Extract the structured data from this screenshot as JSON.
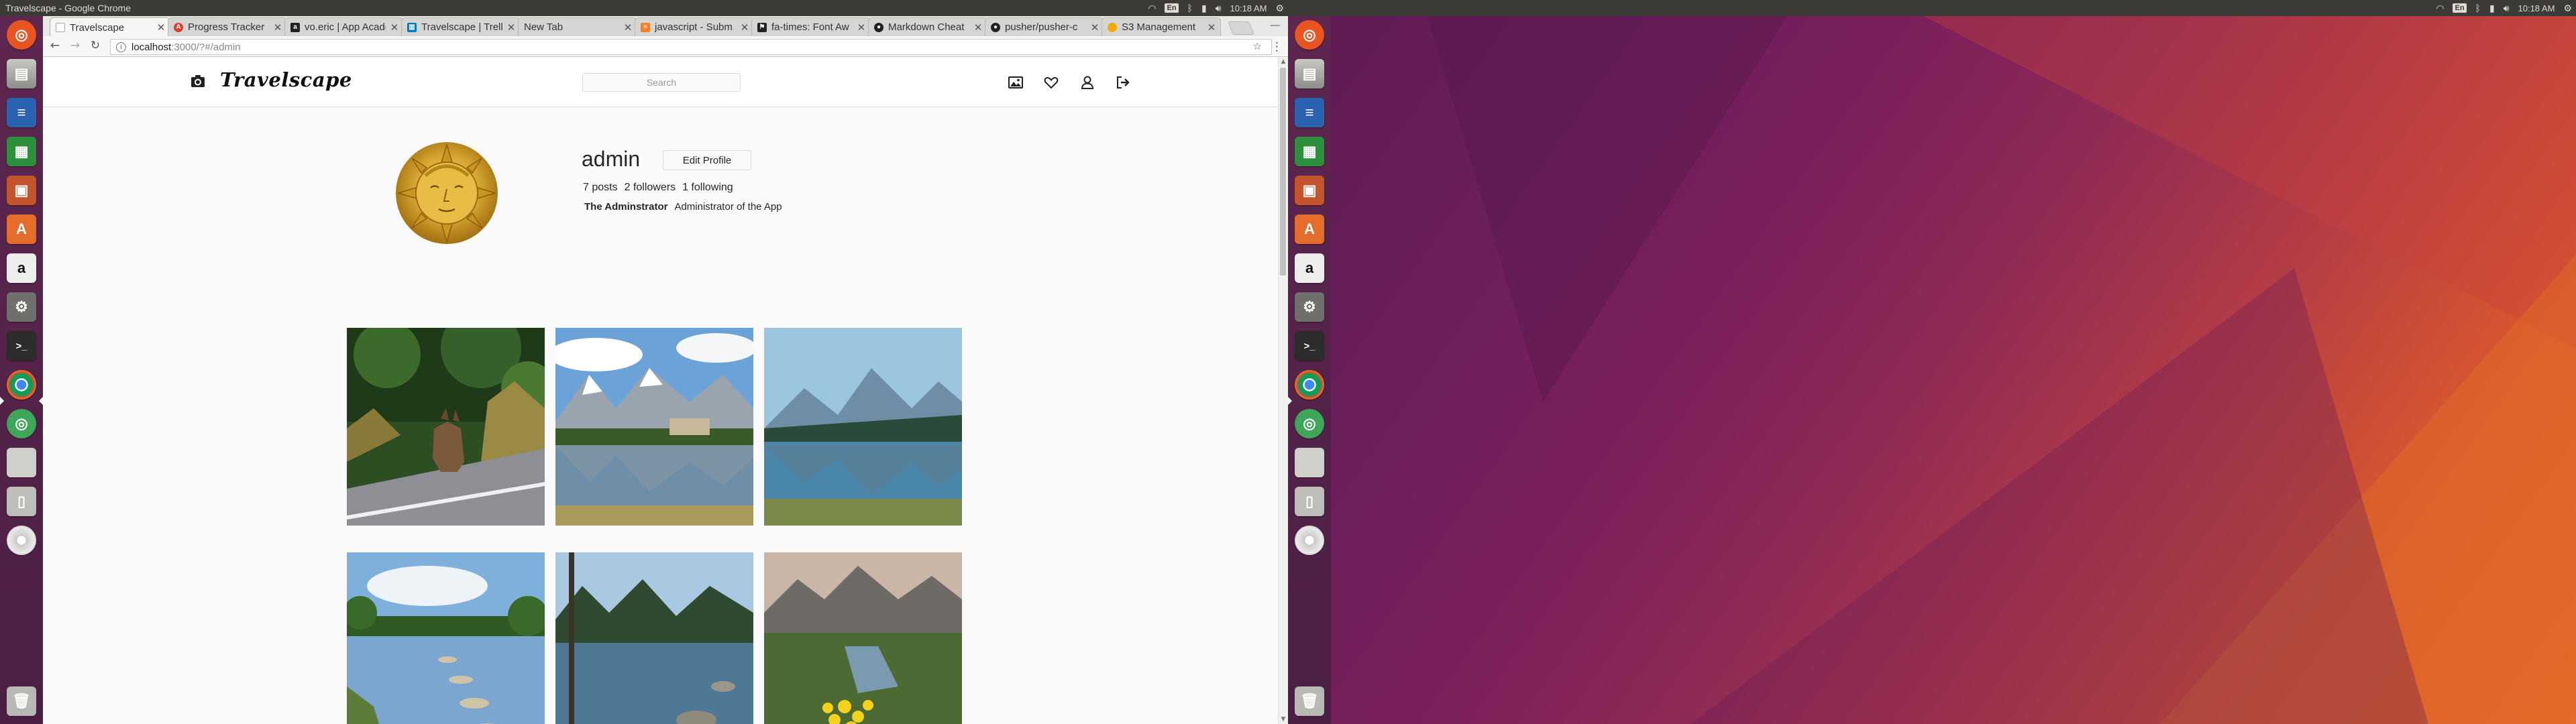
{
  "os": {
    "window_title": "Travelscape - Google Chrome",
    "clock": "10:18 AM",
    "keyboard_indicator": "En"
  },
  "launcher": {
    "icons": [
      "ubuntu-dash-icon",
      "files-icon",
      "writer-icon",
      "calc-icon",
      "impress-icon",
      "software-center-icon",
      "amazon-icon",
      "settings-icon",
      "terminal-icon",
      "chrome-icon",
      "system-icon",
      "drive-icon",
      "usb-drive-icon",
      "dvd-icon",
      "trash-icon"
    ]
  },
  "browser": {
    "tabs": [
      {
        "title": "Travelscape",
        "favicon_color": "#ffffff"
      },
      {
        "title": "Progress Tracker",
        "favicon_color": "#dd3c34"
      },
      {
        "title": "vo.eric | App Academy",
        "favicon_color": "#222222"
      },
      {
        "title": "Travelscape | Trello",
        "favicon_color": "#0079bf"
      },
      {
        "title": "New Tab",
        "favicon_color": "#cccccc"
      },
      {
        "title": "javascript - Subm",
        "favicon_color": "#f48024"
      },
      {
        "title": "fa-times: Font Aw",
        "favicon_color": "#222222"
      },
      {
        "title": "Markdown Cheat",
        "favicon_color": "#222222"
      },
      {
        "title": "pusher/pusher-c",
        "favicon_color": "#222222"
      },
      {
        "title": "S3 Management",
        "favicon_color": "#f7a80d"
      }
    ],
    "url_host": "localhost",
    "url_path": ":3000/?#/admin"
  },
  "app": {
    "brand": "Travelscape",
    "search_placeholder": "Search",
    "profile": {
      "username": "admin",
      "edit_label": "Edit Profile",
      "posts": "7 posts",
      "followers": "2 followers",
      "following": "1 following",
      "full_name": "The Adminstrator",
      "bio": "Administrator of the App"
    },
    "photos": [
      "wolf on road",
      "mountain lake with hotel",
      "misty mountain lake",
      "stepping stones lake",
      "forest lake with rocks",
      "mountain stream with yellow flowers"
    ]
  }
}
